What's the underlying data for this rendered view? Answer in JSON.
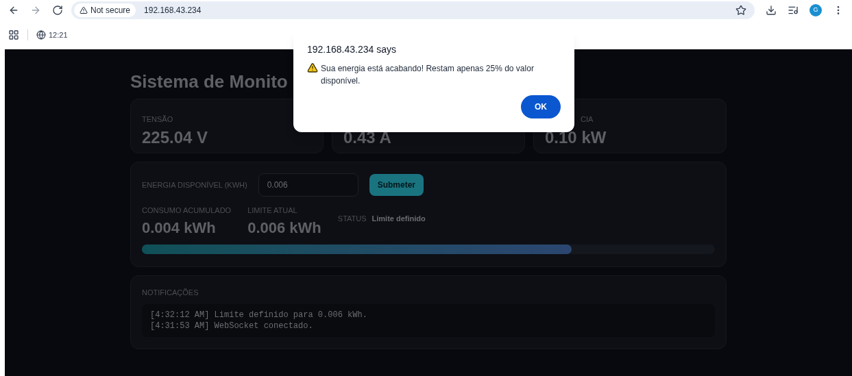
{
  "browser": {
    "security": "Not secure",
    "url": "192.168.43.234",
    "profile": "G",
    "tab_time": "12:21"
  },
  "page": {
    "title": "Sistema de Monito",
    "cards": [
      {
        "label": "TENSÃO",
        "value": "225.04 V"
      },
      {
        "value": "0.43 A"
      },
      {
        "label": "CIA",
        "value": "0.10 kW"
      }
    ],
    "energy": {
      "label": "ENERGIA DISPONÍVEL (KWH)",
      "input_value": "0.006",
      "submit": "Submeter",
      "stats": [
        {
          "label": "CONSUMO ACUMULADO",
          "value": "0.004 kWh"
        },
        {
          "label": "LIMITE ATUAL",
          "value": "0.006 kWh"
        }
      ],
      "status_label": "STATUS",
      "status_value": "Limite definido",
      "level": 0.75
    },
    "notifications": {
      "title": "NOTIFICAÇÕES",
      "lines": [
        "[4:32:12 AM] Limite definido para 0.006 kWh.",
        "[4:31:53 AM] WebSocket conectado."
      ]
    }
  },
  "dialog": {
    "title": "192.168.43.234 says",
    "message": "Sua energia está acabando! Restam apenas 25% do valor disponível.",
    "ok": "OK"
  }
}
